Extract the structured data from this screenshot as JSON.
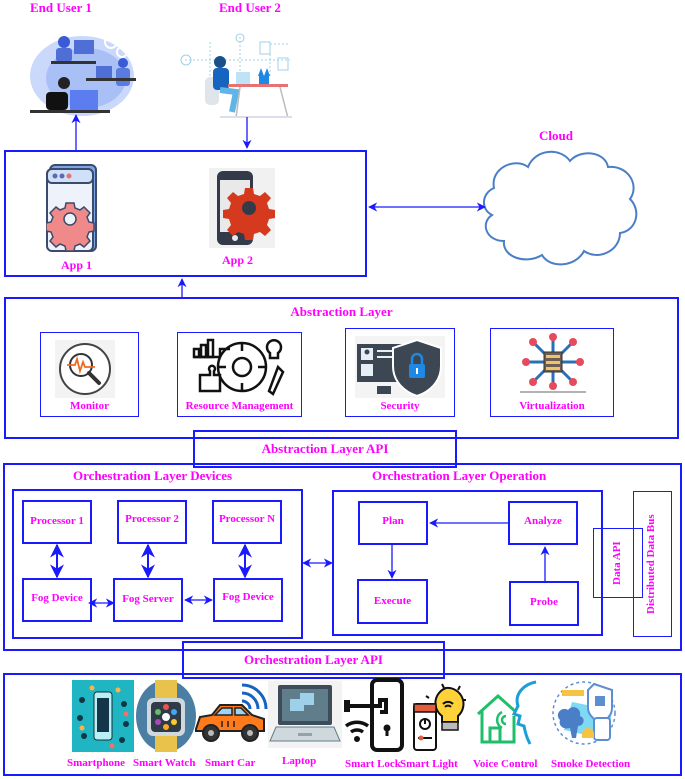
{
  "users": {
    "user1": {
      "label": "End User 1",
      "icon": "people-at-desks-icon"
    },
    "user2": {
      "label": "End User 2",
      "icon": "person-at-laptop-icon"
    }
  },
  "apps": [
    {
      "label": "App 1",
      "icon": "app-window-gear-icon"
    },
    {
      "label": "App 2",
      "icon": "phone-gear-icon"
    }
  ],
  "cloud": {
    "label": "Cloud",
    "icon": "cloud-icon"
  },
  "abstraction_layer": {
    "title": "Abstraction Layer",
    "modules": [
      {
        "label": "Monitor",
        "icon": "magnifier-pulse-icon"
      },
      {
        "label": "Resource Management",
        "icon": "resource-gear-icon"
      },
      {
        "label": "Security",
        "icon": "shield-lock-icon"
      },
      {
        "label": "Virtualization",
        "icon": "server-network-icon"
      }
    ],
    "api_label": "Abstraction Layer API"
  },
  "orchestration_layer": {
    "devices": {
      "title": "Orchestration Layer Devices",
      "processors": [
        "Processor 1",
        "Processor 2",
        "Processor N"
      ],
      "fog_nodes": [
        "Fog Device",
        "Fog Server",
        "Fog Device"
      ]
    },
    "operation": {
      "title": "Orchestration Layer Operation",
      "steps": {
        "plan": "Plan",
        "analyze": "Analyze",
        "execute": "Execute",
        "probe": "Probe"
      },
      "data_api": "Data API"
    },
    "data_bus": "Distributed Data Bus",
    "api_label": "Orchestration Layer API"
  },
  "devices": [
    {
      "label": "Smartphone",
      "icon": "smartphone-icon"
    },
    {
      "label": "Smart Watch",
      "icon": "smart-watch-icon"
    },
    {
      "label": "Smart Car",
      "icon": "smart-car-icon"
    },
    {
      "label": "Laptop",
      "icon": "laptop-icon"
    },
    {
      "label": "Smart Lock",
      "icon": "smart-lock-icon"
    },
    {
      "label": "Smart Light",
      "icon": "smart-light-icon"
    },
    {
      "label": "Voice Control",
      "icon": "voice-control-icon"
    },
    {
      "label": "Smoke Detection",
      "icon": "smoke-detection-icon"
    }
  ],
  "colors": {
    "line": "#1a1aff",
    "label": "#ff00ff",
    "cloud": "#4a7fc8"
  }
}
